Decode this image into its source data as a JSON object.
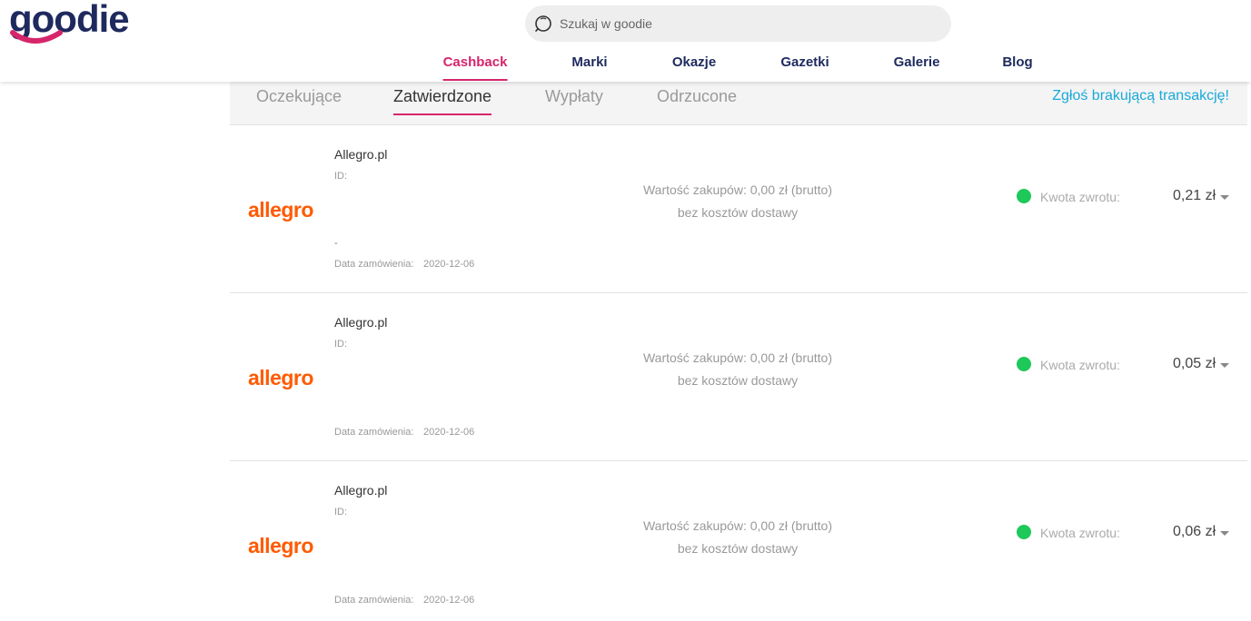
{
  "header": {
    "logo_text": "goodie",
    "search": {
      "placeholder": "Szukaj w goodie",
      "icon": "search-icon"
    },
    "nav": [
      {
        "label": "Cashback",
        "active": true
      },
      {
        "label": "Marki",
        "active": false
      },
      {
        "label": "Okazje",
        "active": false
      },
      {
        "label": "Gazetki",
        "active": false
      },
      {
        "label": "Galerie",
        "active": false
      },
      {
        "label": "Blog",
        "active": false
      }
    ]
  },
  "tabs": {
    "items": [
      {
        "label": "Oczekujące",
        "active": false
      },
      {
        "label": "Zatwierdzone",
        "active": true
      },
      {
        "label": "Wypłaty",
        "active": false
      },
      {
        "label": "Odrzucone",
        "active": false
      }
    ],
    "report_link": "Zgłoś brakującą transakcję!"
  },
  "transactions": [
    {
      "logo_text": "allegro",
      "shop": "Allegro.pl",
      "id_label": "ID:",
      "dash": "-",
      "date_label": "Data zamówienia:",
      "date": "2020-12-06",
      "value_line1": "Wartość zakupów: 0,00 zł (brutto)",
      "value_line2": "bez kosztów dostawy",
      "kwota_label": "Kwota zwrotu:",
      "amount": "0,21 zł",
      "status_color": "#1ec85a"
    },
    {
      "logo_text": "allegro",
      "shop": "Allegro.pl",
      "id_label": "ID:",
      "dash": "",
      "date_label": "Data zamówienia:",
      "date": "2020-12-06",
      "value_line1": "Wartość zakupów: 0,00 zł (brutto)",
      "value_line2": "bez kosztów dostawy",
      "kwota_label": "Kwota zwrotu:",
      "amount": "0,05 zł",
      "status_color": "#1ec85a"
    },
    {
      "logo_text": "allegro",
      "shop": "Allegro.pl",
      "id_label": "ID:",
      "dash": "",
      "date_label": "Data zamówienia:",
      "date": "2020-12-06",
      "value_line1": "Wartość zakupów: 0,00 zł (brutto)",
      "value_line2": "bez kosztów dostawy",
      "kwota_label": "Kwota zwrotu:",
      "amount": "0,06 zł",
      "status_color": "#1ec85a"
    }
  ],
  "colors": {
    "brand_navy": "#1e2a5e",
    "brand_pink": "#d6256b",
    "link_blue": "#19a9d9",
    "allegro_orange": "#ff5a00",
    "status_green": "#1ec85a"
  }
}
